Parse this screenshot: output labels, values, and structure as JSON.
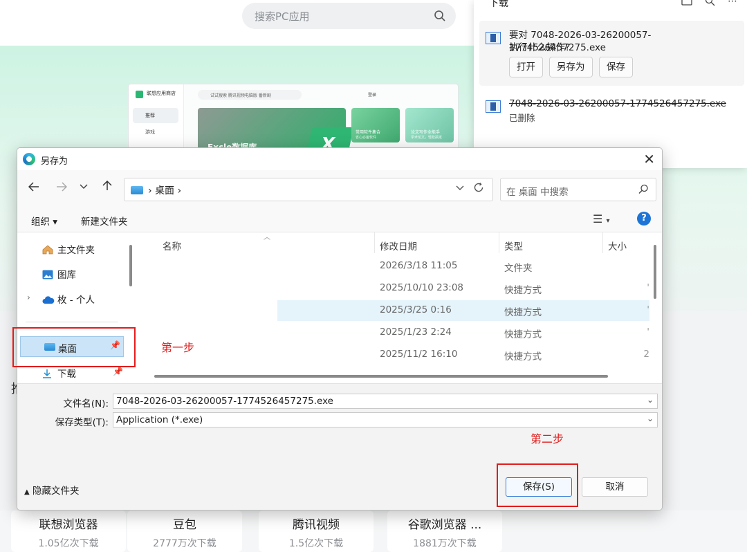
{
  "store": {
    "search_placeholder": "搜索PC应用",
    "thumbnail": {
      "brand": "联想应用商店",
      "nav_recommend": "推荐",
      "nav_games": "游戏",
      "search_text": "试试搜索 腾讯视频电脑版 番新剧",
      "login": "登录",
      "banner_title": "Excle数据库",
      "card1_title": "常用软件集合",
      "card1_sub": "省心必备软件",
      "card2_title": "论文写作全能手",
      "card2_sub": "学术论文，轻松搞定"
    },
    "apps": [
      {
        "name": "联想浏览器",
        "downloads": "1.05亿次下载"
      },
      {
        "name": "豆包",
        "downloads": "2777万次下载"
      },
      {
        "name": "腾讯视频",
        "downloads": "1.5亿次下载"
      },
      {
        "name": "谷歌浏览器 ...",
        "downloads": "1881万次下载"
      }
    ],
    "cut_text": "推"
  },
  "downloads": {
    "title": "下载",
    "item1": {
      "line1": "要对 7048-2026-03-26200057-1774526457275.exe",
      "line2": "执行什么操作?",
      "open": "打开",
      "save_as": "另存为",
      "save": "保存"
    },
    "item2": {
      "filename": "7048-2026-03-26200057-1774526457275.exe",
      "status": "已删除"
    }
  },
  "dialog": {
    "title": "另存为",
    "breadcrumb": "桌面",
    "search_placeholder": "在 桌面 中搜索",
    "toolbar": {
      "organize": "组织 ▾",
      "new_folder": "新建文件夹"
    },
    "nav": {
      "home": "主文件夹",
      "gallery": "图库",
      "onedrive": "枚 - 个人",
      "desktop": "桌面",
      "downloads": "下载"
    },
    "columns": {
      "name": "名称",
      "modified": "修改日期",
      "type": "类型",
      "size": "大小"
    },
    "rows": [
      {
        "date": "2026/3/18 11:05",
        "type": "文件夹",
        "tick": ""
      },
      {
        "date": "2025/10/10 23:08",
        "type": "快捷方式",
        "tick": "'"
      },
      {
        "date": "2025/3/25 0:16",
        "type": "快捷方式",
        "tick": "'"
      },
      {
        "date": "2025/1/23 2:24",
        "type": "快捷方式",
        "tick": "'"
      },
      {
        "date": "2025/11/2 16:10",
        "type": "快捷方式",
        "tick": "2"
      }
    ],
    "filename_label": "文件名(N):",
    "filename_value": "7048-2026-03-26200057-1774526457275.exe",
    "filetype_label": "保存类型(T):",
    "filetype_value": "Application (*.exe)",
    "hide_folders": "隐藏文件夹",
    "save_button": "保存(S)",
    "cancel_button": "取消"
  },
  "annotations": {
    "step1": "第一步",
    "step2": "第二步"
  },
  "colors": {
    "accent": "#1e74d6",
    "annotation": "#e31b1b",
    "selection": "#cce4f7"
  }
}
